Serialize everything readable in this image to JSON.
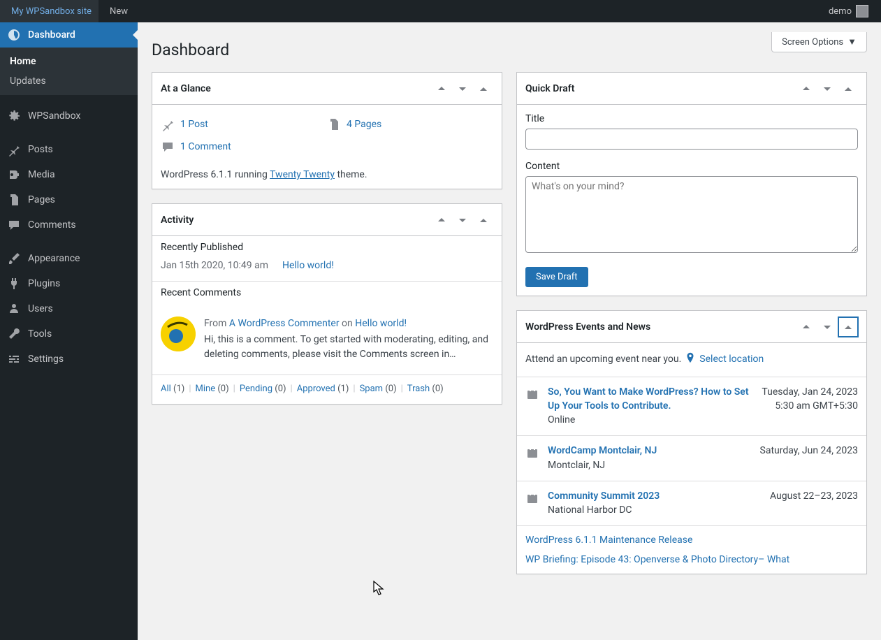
{
  "adminbar": {
    "site_name": "My WPSandbox site",
    "new_label": "New",
    "user": "demo"
  },
  "sidebar": {
    "dashboard": "Dashboard",
    "home": "Home",
    "updates": "Updates",
    "wpsandbox": "WPSandbox",
    "posts": "Posts",
    "media": "Media",
    "pages": "Pages",
    "comments": "Comments",
    "appearance": "Appearance",
    "plugins": "Plugins",
    "users": "Users",
    "tools": "Tools",
    "settings": "Settings"
  },
  "page": {
    "title": "Dashboard",
    "screen_options": "Screen Options"
  },
  "glance": {
    "heading": "At a Glance",
    "items": {
      "posts": "1 Post",
      "pages": "4 Pages",
      "comments": "1 Comment"
    },
    "footer_pre": "WordPress 6.1.1 running ",
    "theme": "Twenty Twenty",
    "footer_post": " theme."
  },
  "activity": {
    "heading": "Activity",
    "recently_published": "Recently Published",
    "pub_time": "Jan 15th 2020, 10:49 am",
    "pub_title": "Hello world!",
    "recent_comments": "Recent Comments",
    "comment": {
      "from": "From ",
      "author": "A WordPress Commenter",
      "on": " on ",
      "post": "Hello world!",
      "body": "Hi, this is a comment. To get started with moderating, editing, and deleting comments, please visit the Comments screen in…"
    },
    "filters": {
      "all": "All",
      "all_n": "(1)",
      "mine": "Mine",
      "mine_n": "(0)",
      "pending": "Pending",
      "pending_n": "(0)",
      "approved": "Approved",
      "approved_n": "(1)",
      "spam": "Spam",
      "spam_n": "(0)",
      "trash": "Trash",
      "trash_n": "(0)"
    }
  },
  "quickdraft": {
    "heading": "Quick Draft",
    "title_label": "Title",
    "content_label": "Content",
    "content_placeholder": "What's on your mind?",
    "save": "Save Draft"
  },
  "events": {
    "heading": "WordPress Events and News",
    "attend": "Attend an upcoming event near you.",
    "select_location": "Select location",
    "list": [
      {
        "title": "So, You Want to Make WordPress? How to Set Up Your Tools to Contribute.",
        "loc": "Online",
        "date": "Tuesday, Jan 24, 2023",
        "date2": "5:30 am GMT+5:30",
        "type": "meetup"
      },
      {
        "title": "WordCamp Montclair, NJ",
        "loc": "Montclair, NJ",
        "date": "Saturday, Jun 24, 2023",
        "date2": "",
        "type": "camp"
      },
      {
        "title": "Community Summit 2023",
        "loc": "National Harbor DC",
        "date": "August 22–23, 2023",
        "date2": "",
        "type": "camp"
      }
    ],
    "news": [
      "WordPress 6.1.1 Maintenance Release",
      "WP Briefing: Episode 43: Openverse & Photo Directory– What"
    ]
  }
}
